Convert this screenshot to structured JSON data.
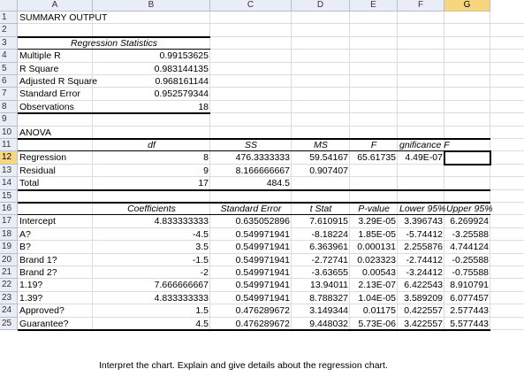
{
  "columns": [
    "A",
    "B",
    "C",
    "D",
    "E",
    "F",
    "G"
  ],
  "selected_column": "G",
  "selected_row": "12",
  "rows": [
    {
      "n": "1",
      "cells": {
        "A": "SUMMARY OUTPUT"
      }
    },
    {
      "n": "2",
      "cells": {}
    },
    {
      "n": "3",
      "cells": {
        "AB": "Regression Statistics"
      }
    },
    {
      "n": "4",
      "cells": {
        "A": "Multiple R",
        "B": "0.99153625"
      }
    },
    {
      "n": "5",
      "cells": {
        "A": "R Square",
        "B": "0.983144135"
      }
    },
    {
      "n": "6",
      "cells": {
        "A": "Adjusted R Square",
        "B": "0.968161144"
      }
    },
    {
      "n": "7",
      "cells": {
        "A": "Standard Error",
        "B": "0.952579344"
      }
    },
    {
      "n": "8",
      "cells": {
        "A": "Observations",
        "B": "18"
      }
    },
    {
      "n": "9",
      "cells": {}
    },
    {
      "n": "10",
      "cells": {
        "A": "ANOVA"
      }
    },
    {
      "n": "11",
      "cells": {
        "B": "df",
        "C": "SS",
        "D": "MS",
        "E": "F",
        "F": "gnificance F"
      }
    },
    {
      "n": "12",
      "cells": {
        "A": "Regression",
        "B": "8",
        "C": "476.3333333",
        "D": "59.54167",
        "E": "65.61735",
        "F": "4.49E-07"
      }
    },
    {
      "n": "13",
      "cells": {
        "A": "Residual",
        "B": "9",
        "C": "8.166666667",
        "D": "0.907407"
      }
    },
    {
      "n": "14",
      "cells": {
        "A": "Total",
        "B": "17",
        "C": "484.5"
      }
    },
    {
      "n": "15",
      "cells": {}
    },
    {
      "n": "16",
      "cells": {
        "B": "Coefficients",
        "C": "Standard Error",
        "D": "t Stat",
        "E": "P-value",
        "F": "Lower 95%",
        "G": "Upper 95%"
      }
    },
    {
      "n": "17",
      "cells": {
        "A": "Intercept",
        "B": "4.833333333",
        "C": "0.635052896",
        "D": "7.610915",
        "E": "3.29E-05",
        "F": "3.396743",
        "G": "6.269924"
      }
    },
    {
      "n": "18",
      "cells": {
        "A": "A?",
        "B": "-4.5",
        "C": "0.549971941",
        "D": "-8.18224",
        "E": "1.85E-05",
        "F": "-5.74412",
        "G": "-3.25588"
      }
    },
    {
      "n": "19",
      "cells": {
        "A": "B?",
        "B": "3.5",
        "C": "0.549971941",
        "D": "6.363961",
        "E": "0.000131",
        "F": "2.255876",
        "G": "4.744124"
      }
    },
    {
      "n": "20",
      "cells": {
        "A": "Brand 1?",
        "B": "-1.5",
        "C": "0.549971941",
        "D": "-2.72741",
        "E": "0.023323",
        "F": "-2.74412",
        "G": "-0.25588"
      }
    },
    {
      "n": "21",
      "cells": {
        "A": "Brand 2?",
        "B": "-2",
        "C": "0.549971941",
        "D": "-3.63655",
        "E": "0.00543",
        "F": "-3.24412",
        "G": "-0.75588"
      }
    },
    {
      "n": "22",
      "cells": {
        "A": "1.19?",
        "B": "7.666666667",
        "C": "0.549971941",
        "D": "13.94011",
        "E": "2.13E-07",
        "F": "6.422543",
        "G": "8.910791"
      }
    },
    {
      "n": "23",
      "cells": {
        "A": "1.39?",
        "B": "4.833333333",
        "C": "0.549971941",
        "D": "8.788327",
        "E": "1.04E-05",
        "F": "3.589209",
        "G": "6.077457"
      }
    },
    {
      "n": "24",
      "cells": {
        "A": "Approved?",
        "B": "1.5",
        "C": "0.476289672",
        "D": "3.149344",
        "E": "0.01175",
        "F": "0.422557",
        "G": "2.577443"
      }
    },
    {
      "n": "25",
      "cells": {
        "A": "Guarantee?",
        "B": "4.5",
        "C": "0.476289672",
        "D": "9.448032",
        "E": "5.73E-06",
        "F": "3.422557",
        "G": "5.577443"
      }
    }
  ],
  "caption": "Interpret the chart. Explain and give details about the regression chart."
}
